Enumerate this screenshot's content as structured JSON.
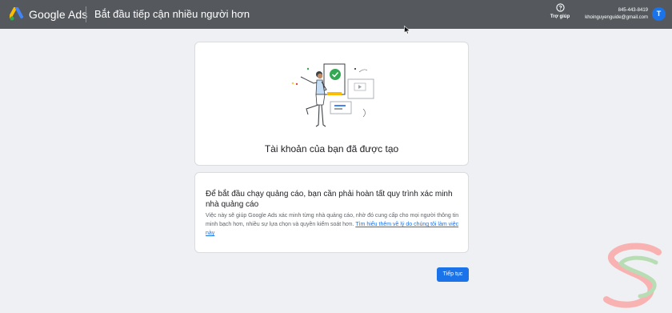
{
  "header": {
    "brand": "Google Ads",
    "page_heading": "Bắt đầu tiếp cận nhiều người hơn",
    "help_label": "Trợ giúp",
    "help_icon": "help-circle-icon",
    "account_phone": "845-443-8419",
    "account_email": "khoinguyenguide@gmail.com",
    "avatar_letter": "T"
  },
  "created_card": {
    "title": "Tài khoản của bạn đã được tạo",
    "illustration": "woman-celebrating-with-checkmark-illustration"
  },
  "verification_card": {
    "title": "Để bắt đầu chạy quảng cáo, bạn cần phải hoàn tất quy trình xác minh nhà quảng cáo",
    "body": "Việc này sẽ giúp Google Ads xác minh từng nhà quảng cáo, nhờ đó cung cấp cho mọi người thông tin minh bạch hơn, nhiều sự lựa chọn và quyền kiểm soát hơn.",
    "link": "Tìm hiểu thêm về lý do chúng tôi làm việc này"
  },
  "actions": {
    "continue_label": "Tiếp tục"
  },
  "colors": {
    "topbar": "#55595e",
    "background": "#eef0f3",
    "primary": "#1a73e8",
    "success": "#34a853"
  }
}
